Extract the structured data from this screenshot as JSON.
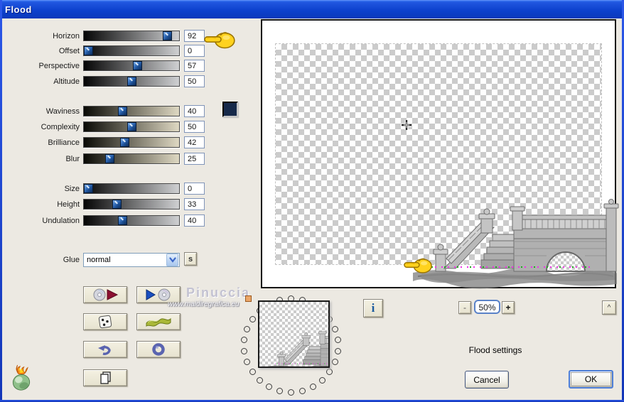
{
  "window": {
    "title": "Flood"
  },
  "sliders": [
    {
      "label": "Horizon",
      "value": 92
    },
    {
      "label": "Offset",
      "value": 0
    },
    {
      "label": "Perspective",
      "value": 57
    },
    {
      "label": "Altitude",
      "value": 50
    },
    {
      "label": "Waviness",
      "value": 40
    },
    {
      "label": "Complexity",
      "value": 50
    },
    {
      "label": "Brilliance",
      "value": 42
    },
    {
      "label": "Blur",
      "value": 25
    },
    {
      "label": "Size",
      "value": 0
    },
    {
      "label": "Height",
      "value": 33
    },
    {
      "label": "Undulation",
      "value": 40
    }
  ],
  "glue": {
    "label": "Glue",
    "selected": "normal",
    "style_button": "s"
  },
  "swatch_color": "#16294a",
  "icons": {
    "open_preset": "cd-red-play-icon",
    "save_preset": "blue-play-cd-icon",
    "randomize": "dice-icon",
    "wave_style": "green-wave-icon",
    "undo": "undo-arrow-icon",
    "reset": "ring-icon",
    "copy": "copy-pages-icon",
    "pointer": "yellow-hand-icon",
    "logo": "flaming-pear-icon"
  },
  "info_button": "i",
  "collapse_button": "^",
  "zoom": {
    "out": "-",
    "level": "50%",
    "in": "+"
  },
  "status_text": "Flood settings",
  "actions": {
    "cancel": "Cancel",
    "ok": "OK"
  },
  "watermark": {
    "name": "Pinuccia",
    "site": "www.maidiregrafica.eu"
  }
}
